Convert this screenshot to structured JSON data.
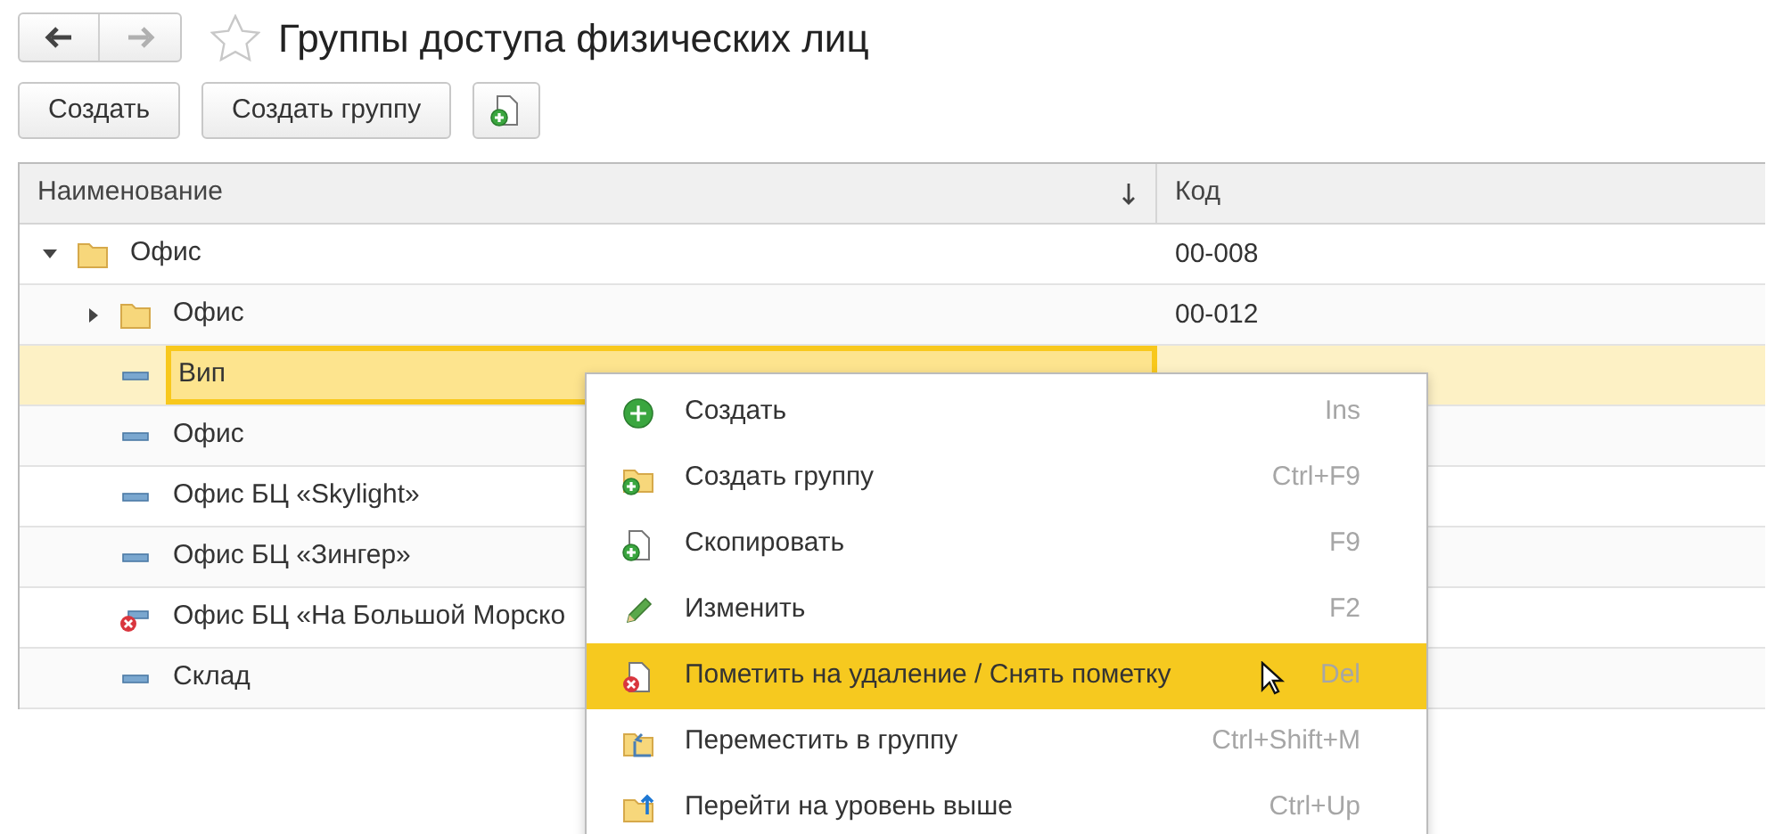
{
  "nav": {
    "back_enabled": true,
    "forward_enabled": false
  },
  "favorite": false,
  "title": "Группы доступа физических лиц",
  "toolbar": [
    "Создать",
    "Создать группу"
  ],
  "table": {
    "columns": [
      {
        "label": "Наименование"
      },
      {
        "label": "Код"
      }
    ],
    "rows": [
      {
        "kind": "folder",
        "name": "Офис",
        "code": "00-008",
        "expanded": true,
        "selected": false,
        "children": [
          {
            "kind": "folder",
            "name": "Офис",
            "code": "00-012",
            "expanded": false,
            "selected": false
          },
          {
            "kind": "item",
            "name": "Вип",
            "selected": true
          },
          {
            "kind": "item",
            "name": "Офис",
            "selected": false
          },
          {
            "kind": "item",
            "name": "Офис БЦ «Skylight»",
            "selected": false
          },
          {
            "kind": "item",
            "name": "Офис БЦ «Зингер»",
            "selected": false
          },
          {
            "kind": "deleted",
            "name": "Офис БЦ «На Большой Морско",
            "selected": false
          },
          {
            "kind": "item",
            "name": "Склад",
            "selected": false
          }
        ]
      }
    ]
  },
  "context_menu": {
    "items": [
      {
        "kind": "create",
        "label": "Создать",
        "shortcut": "Ins",
        "selected": false
      },
      {
        "kind": "group",
        "label": "Создать группу",
        "shortcut": "Ctrl+F9",
        "selected": false
      },
      {
        "kind": "copy",
        "label": "Скопировать",
        "shortcut": "F9",
        "selected": false
      },
      {
        "kind": "edit",
        "label": "Изменить",
        "shortcut": "F2",
        "selected": false
      },
      {
        "kind": "delete",
        "label": "Пометить на удаление / Снять пометку",
        "shortcut": "Del",
        "selected": true
      },
      {
        "kind": "move",
        "label": "Переместить в группу",
        "shortcut": "Ctrl+Shift+M",
        "selected": false
      },
      {
        "kind": "up",
        "label": "Перейти на уровень выше",
        "shortcut": "Ctrl+Up",
        "selected": false
      }
    ]
  }
}
